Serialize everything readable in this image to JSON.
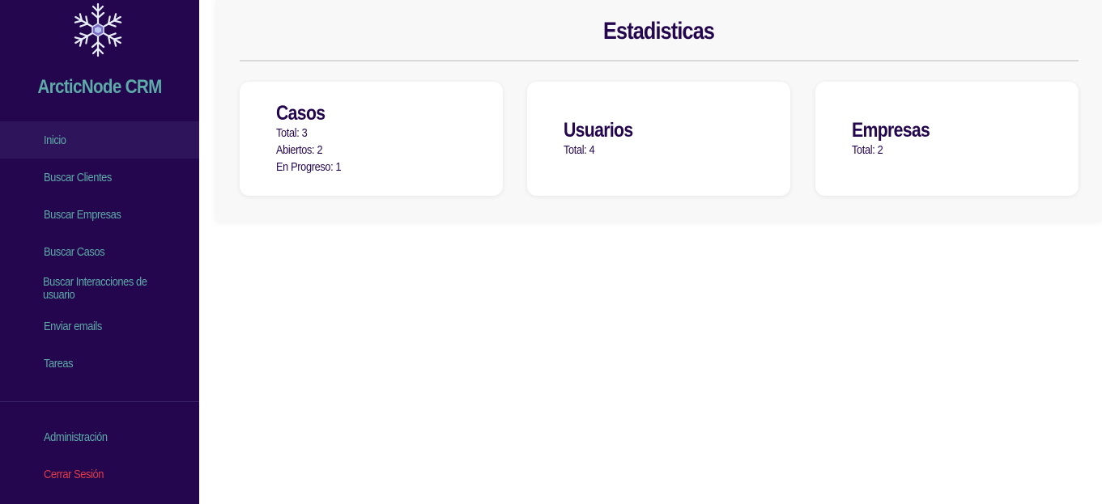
{
  "app": {
    "brand": "ArcticNode CRM",
    "logo_icon": "snowflake-icon"
  },
  "sidebar": {
    "items": [
      {
        "label": "Inicio",
        "active": true
      },
      {
        "label": "Buscar Clientes"
      },
      {
        "label": "Buscar Empresas"
      },
      {
        "label": "Buscar Casos"
      },
      {
        "label": "Buscar Interacciones de usuario"
      },
      {
        "label": "Enviar emails"
      },
      {
        "label": "Tareas"
      }
    ],
    "bottom_items": [
      {
        "label": "Administración"
      },
      {
        "label": "Cerrar Sesión"
      }
    ]
  },
  "main": {
    "title": "Estadisticas",
    "cards": [
      {
        "title": "Casos",
        "lines": [
          "Total: 3",
          "Abiertos: 2",
          "En Progreso: 1"
        ]
      },
      {
        "title": "Usuarios",
        "lines": [
          "Total: 4"
        ]
      },
      {
        "title": "Empresas",
        "lines": [
          "Total: 2"
        ]
      }
    ]
  },
  "colors": {
    "sidebar_bg": "#23064d",
    "accent": "#5eaaa8",
    "logout": "#e03a4a",
    "heading": "#23064d"
  }
}
